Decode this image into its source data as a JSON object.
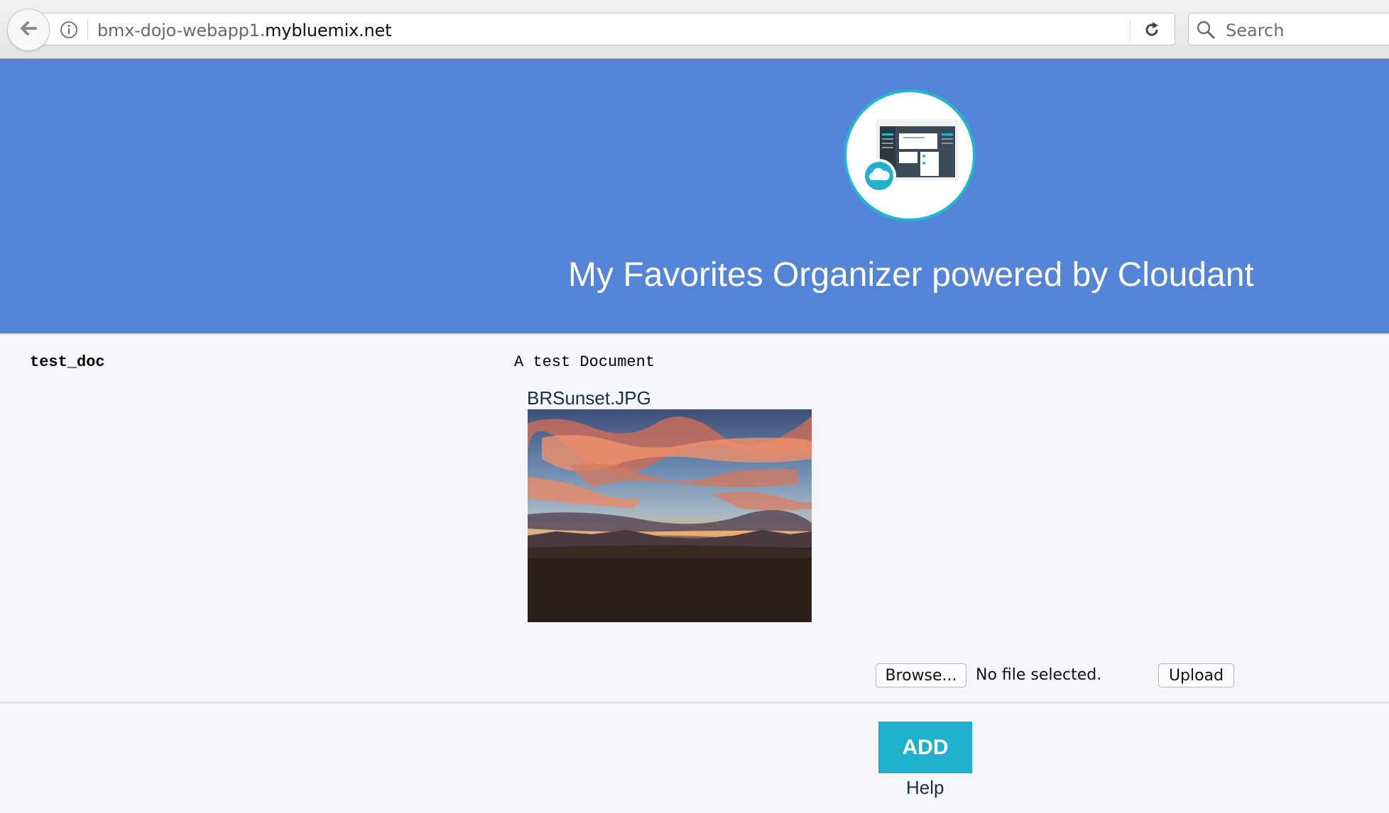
{
  "browser": {
    "url_subdomain": "bmx-dojo-webapp1.",
    "url_domain": "mybluemix.net",
    "search_placeholder": "Search"
  },
  "header": {
    "title": "My Favorites Organizer powered by Cloudant",
    "logo": "favorites-organizer-logo"
  },
  "document": {
    "name": "test_doc",
    "description": "A test Document",
    "attachment": {
      "filename": "BRSunset.JPG"
    }
  },
  "upload": {
    "browse_label": "Browse...",
    "status_text": "No file selected.",
    "upload_label": "Upload"
  },
  "actions": {
    "add_label": "ADD",
    "help_label": "Help"
  },
  "colors": {
    "header_bg": "#5384d8",
    "accent": "#1eb0cd",
    "page_bg": "#f4f6fa"
  }
}
